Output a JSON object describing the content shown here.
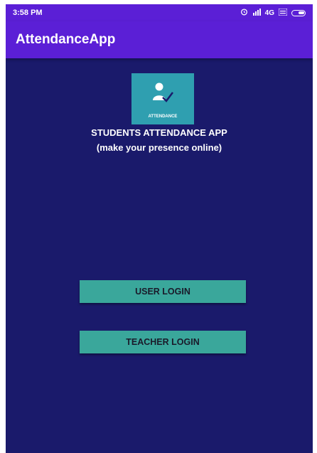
{
  "status_bar": {
    "time": "3:58 PM",
    "signal_text": "4G",
    "icons": [
      "alarm-icon",
      "signal-icon",
      "volte-icon",
      "battery-icon"
    ]
  },
  "app_bar": {
    "title": "AttendanceApp"
  },
  "logo": {
    "label": "ATTENDANCE"
  },
  "header": {
    "title": "STUDENTS ATTENDANCE APP",
    "subtitle": "(make your presence online)"
  },
  "buttons": {
    "user_login": "USER LOGIN",
    "teacher_login": "TEACHER LOGIN"
  },
  "colors": {
    "background": "#1a1a6b",
    "primary": "#5b1fd6",
    "button": "#3aa79b",
    "logo": "#2f9fb0"
  }
}
